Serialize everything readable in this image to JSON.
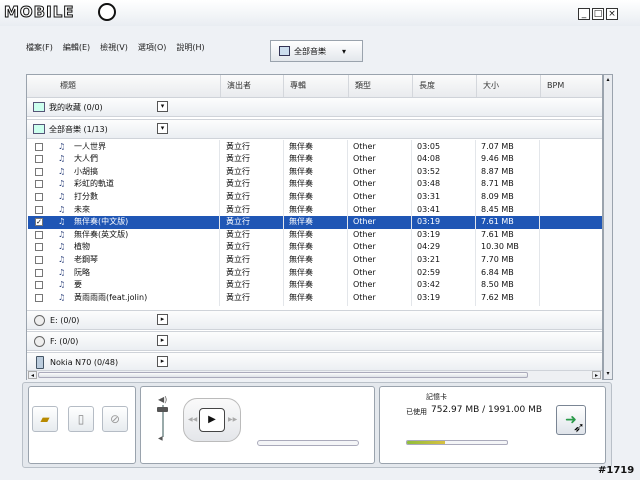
{
  "brand": "MOBILE",
  "window": {
    "min": "_",
    "max": "□",
    "close": "×"
  },
  "menu": [
    "檔案(F)",
    "編輯(E)",
    "檢視(V)",
    "選項(O)",
    "說明(H)"
  ],
  "dropdown": {
    "label": "全部音樂",
    "arrow": "▾"
  },
  "columns": [
    "標題",
    "演出者",
    "專輯",
    "類型",
    "長度",
    "大小",
    "BPM"
  ],
  "groups": {
    "favorites": "我的收藏 (0/0)",
    "all_music": "全部音樂 (1/13)",
    "drive_e": "E: (0/0)",
    "drive_f": "F: (0/0)",
    "nokia": "Nokia N70 (0/48)"
  },
  "tracks": [
    {
      "title": "一人世界",
      "artist": "黃立行",
      "album": "無伴奏",
      "genre": "Other",
      "length": "03:05",
      "size": "7.07 MB",
      "checked": false,
      "selected": false
    },
    {
      "title": "大人們",
      "artist": "黃立行",
      "album": "無伴奏",
      "genre": "Other",
      "length": "04:08",
      "size": "9.46 MB",
      "checked": false,
      "selected": false
    },
    {
      "title": "小胡搞",
      "artist": "黃立行",
      "album": "無伴奏",
      "genre": "Other",
      "length": "03:52",
      "size": "8.87 MB",
      "checked": false,
      "selected": false
    },
    {
      "title": "彩虹的軌道",
      "artist": "黃立行",
      "album": "無伴奏",
      "genre": "Other",
      "length": "03:48",
      "size": "8.71 MB",
      "checked": false,
      "selected": false
    },
    {
      "title": "打分數",
      "artist": "黃立行",
      "album": "無伴奏",
      "genre": "Other",
      "length": "03:31",
      "size": "8.09 MB",
      "checked": false,
      "selected": false
    },
    {
      "title": "未來",
      "artist": "黃立行",
      "album": "無伴奏",
      "genre": "Other",
      "length": "03:41",
      "size": "8.45 MB",
      "checked": false,
      "selected": false
    },
    {
      "title": "無伴奏(中文版)",
      "artist": "黃立行",
      "album": "無伴奏",
      "genre": "Other",
      "length": "03:19",
      "size": "7.61 MB",
      "checked": true,
      "selected": true
    },
    {
      "title": "無伴奏(英文版)",
      "artist": "黃立行",
      "album": "無伴奏",
      "genre": "Other",
      "length": "03:19",
      "size": "7.61 MB",
      "checked": false,
      "selected": false
    },
    {
      "title": "植物",
      "artist": "黃立行",
      "album": "無伴奏",
      "genre": "Other",
      "length": "04:29",
      "size": "10.30 MB",
      "checked": false,
      "selected": false
    },
    {
      "title": "老鋼琴",
      "artist": "黃立行",
      "album": "無伴奏",
      "genre": "Other",
      "length": "03:21",
      "size": "7.70 MB",
      "checked": false,
      "selected": false
    },
    {
      "title": "阮略",
      "artist": "黃立行",
      "album": "無伴奏",
      "genre": "Other",
      "length": "02:59",
      "size": "6.84 MB",
      "checked": false,
      "selected": false
    },
    {
      "title": "要",
      "artist": "黃立行",
      "album": "無伴奏",
      "genre": "Other",
      "length": "03:42",
      "size": "8.50 MB",
      "checked": false,
      "selected": false
    },
    {
      "title": "黃雨雨雨(feat.jolin)",
      "artist": "黃立行",
      "album": "無伴奏",
      "genre": "Other",
      "length": "03:19",
      "size": "7.62 MB",
      "checked": false,
      "selected": false
    }
  ],
  "memory": {
    "title": "記憶卡",
    "label": "已使用",
    "value": "752.97 MB / 1991.00 MB",
    "used_fraction": 0.378
  },
  "watermark": "#1719",
  "colors": {
    "selection": "#1f56b5",
    "bar_fill": "#8fbf3a",
    "bar_fill2": "#d8c040"
  }
}
